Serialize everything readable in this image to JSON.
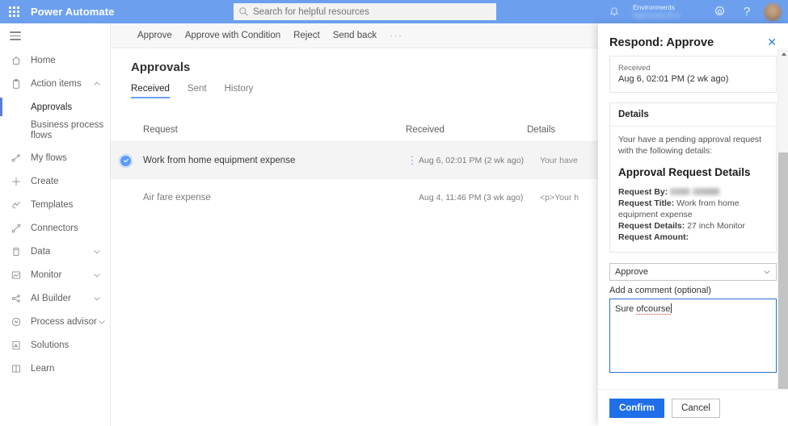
{
  "suite": {
    "waffle_icon": "app-launcher-icon",
    "brand": "Power Automate",
    "search": {
      "placeholder": "Search for helpful resources",
      "value": "",
      "icon": "search-icon"
    },
    "icons": {
      "notification": "bell-icon",
      "settings": "gear-icon",
      "help": "question-mark-icon",
      "avatar": "user-avatar"
    },
    "environment": {
      "label": "Environments",
      "value": ""
    },
    "accent": "#6ca0ef"
  },
  "sidebar": {
    "hamburger_icon": "hamburger-menu-icon",
    "items": [
      {
        "label": "Home",
        "icon": "home-icon",
        "level": 0,
        "expandable": false,
        "selected": false
      },
      {
        "label": "Action items",
        "icon": "clipboard-icon",
        "level": 0,
        "expandable": true,
        "expanded": true,
        "selected": false
      },
      {
        "label": "Approvals",
        "icon": "",
        "level": 1,
        "expandable": false,
        "selected": true
      },
      {
        "label": "Business process flows",
        "icon": "",
        "level": 1,
        "expandable": false,
        "selected": false
      },
      {
        "label": "My flows",
        "icon": "flow-icon",
        "level": 0,
        "expandable": false,
        "selected": false
      },
      {
        "label": "Create",
        "icon": "plus-icon",
        "level": 0,
        "expandable": false,
        "selected": false
      },
      {
        "label": "Templates",
        "icon": "templates-icon",
        "level": 0,
        "expandable": false,
        "selected": false
      },
      {
        "label": "Connectors",
        "icon": "connectors-icon",
        "level": 0,
        "expandable": false,
        "selected": false
      },
      {
        "label": "Data",
        "icon": "database-icon",
        "level": 0,
        "expandable": true,
        "expanded": false,
        "selected": false
      },
      {
        "label": "Monitor",
        "icon": "monitor-icon",
        "level": 0,
        "expandable": true,
        "expanded": false,
        "selected": false
      },
      {
        "label": "AI Builder",
        "icon": "ai-builder-icon",
        "level": 0,
        "expandable": true,
        "expanded": false,
        "selected": false
      },
      {
        "label": "Process advisor",
        "icon": "process-advisor-icon",
        "level": 0,
        "expandable": true,
        "expanded": false,
        "selected": false
      },
      {
        "label": "Solutions",
        "icon": "solutions-icon",
        "level": 0,
        "expandable": false,
        "selected": false
      },
      {
        "label": "Learn",
        "icon": "book-icon",
        "level": 0,
        "expandable": false,
        "selected": false
      }
    ]
  },
  "commandbar": {
    "buttons": [
      "Approve",
      "Approve with Condition",
      "Reject",
      "Send back"
    ],
    "overflow": "···"
  },
  "page": {
    "title": "Approvals",
    "tabs": [
      {
        "label": "Received",
        "active": true
      },
      {
        "label": "Sent",
        "active": false
      },
      {
        "label": "History",
        "active": false
      }
    ],
    "table": {
      "columns": [
        "Request",
        "Received",
        "Details"
      ],
      "rows": [
        {
          "selected": true,
          "check_icon": "check-circle-icon",
          "request": "Work from home equipment expense",
          "kebab_icon": "more-vertical-icon",
          "received": "Aug 6, 02:01 PM (2 wk ago)",
          "details": "Your have"
        },
        {
          "selected": false,
          "check_icon": "",
          "request": "Air fare expense",
          "kebab_icon": "",
          "received": "Aug 4, 11:46 PM (3 wk ago)",
          "details": "<p>Your h"
        }
      ]
    }
  },
  "panel": {
    "title": "Respond: Approve",
    "close_icon": "close-icon",
    "received": {
      "label": "Received",
      "value": "Aug 6, 02:01 PM (2 wk ago)"
    },
    "details": {
      "header": "Details",
      "intro": "Your have a pending approval request with the following details:",
      "heading": "Approval Request Details",
      "fields": [
        {
          "key": "Request By:",
          "value": "",
          "redacted": true
        },
        {
          "key": "Request Title:",
          "value": "Work from home equipment expense",
          "redacted": false
        },
        {
          "key": "Request Details:",
          "value": "27 inch Monitor",
          "redacted": false
        },
        {
          "key": "Request Amount:",
          "value": "",
          "redacted": false
        }
      ]
    },
    "response_dropdown": {
      "value": "Approve",
      "chevron_icon": "chevron-down-icon"
    },
    "comment": {
      "label": "Add a comment (optional)",
      "text_before": "Sure ",
      "text_misspelled": "ofcourse",
      "placeholder": ""
    },
    "footer": {
      "confirm": "Confirm",
      "cancel": "Cancel"
    },
    "scrollbar": {
      "up_icon": "scroll-up-arrow-icon",
      "down_icon": "scroll-down-arrow-icon"
    },
    "primary_color": "#1f6fea",
    "focus_border": "#2b6fd0"
  }
}
